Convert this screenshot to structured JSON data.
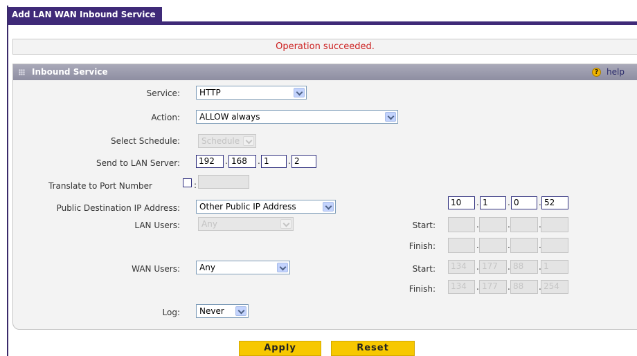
{
  "page": {
    "title": "Add LAN WAN Inbound Service"
  },
  "message": "Operation succeeded.",
  "panel": {
    "title": "Inbound Service",
    "help_label": "help",
    "help_icon": "question-circle-icon"
  },
  "form": {
    "service": {
      "label": "Service:",
      "value": "HTTP"
    },
    "action": {
      "label": "Action:",
      "value": "ALLOW always"
    },
    "schedule": {
      "label": "Select Schedule:",
      "value": "Schedule 1"
    },
    "lan_server": {
      "label": "Send to LAN Server:",
      "octets": [
        "192",
        "168",
        "1",
        "2"
      ]
    },
    "translate_port": {
      "label": "Translate to Port Number",
      "checked": false,
      "value": ""
    },
    "public_dest": {
      "label": "Public Destination IP Address:",
      "value": "Other Public IP Address",
      "octets": [
        "10",
        "1",
        "0",
        "52"
      ]
    },
    "lan_users": {
      "label": "LAN Users:",
      "value": "Any",
      "start": {
        "label": "Start:",
        "octets": [
          "",
          "",
          "",
          ""
        ]
      },
      "finish": {
        "label": "Finish:",
        "octets": [
          "",
          "",
          "",
          ""
        ]
      }
    },
    "wan_users": {
      "label": "WAN Users:",
      "value": "Any",
      "start": {
        "label": "Start:",
        "octets": [
          "134",
          "177",
          "88",
          "1"
        ]
      },
      "finish": {
        "label": "Finish:",
        "octets": [
          "134",
          "177",
          "88",
          "254"
        ]
      }
    },
    "log": {
      "label": "Log:",
      "value": "Never"
    }
  },
  "buttons": {
    "apply": "Apply",
    "reset": "Reset"
  },
  "colors": {
    "accent": "#3f2a78",
    "success_msg": "#cc1f1f",
    "button": "#f7c800"
  }
}
